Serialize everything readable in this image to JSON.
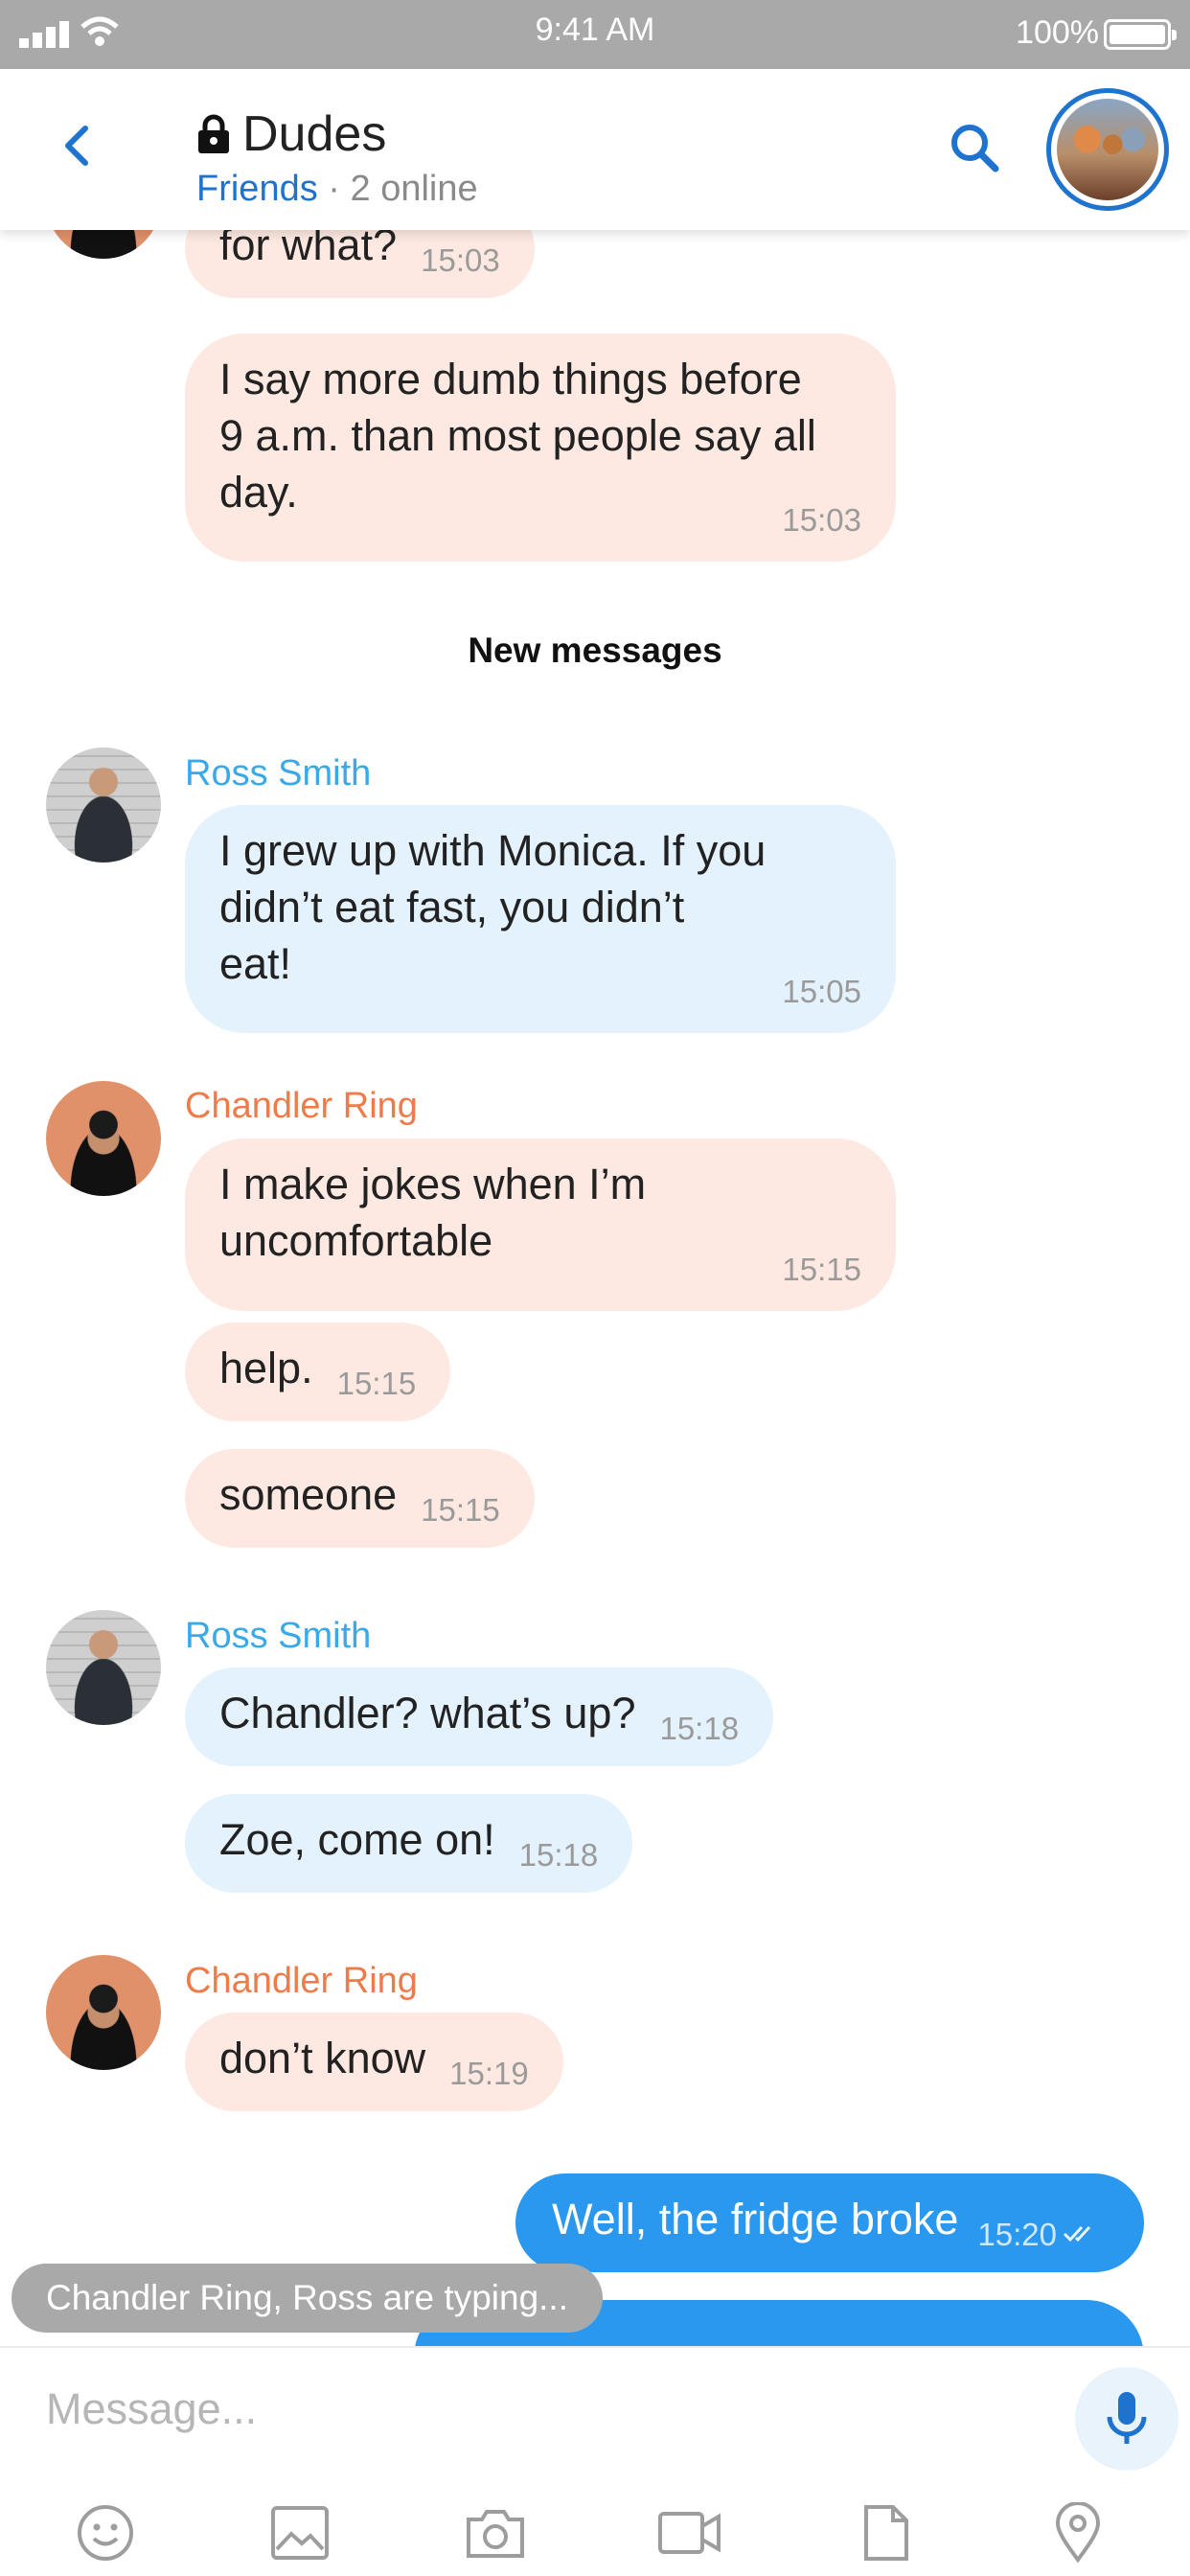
{
  "status_bar": {
    "time": "9:41 AM",
    "battery": "100%"
  },
  "header": {
    "title": "Dudes",
    "group_label": "Friends",
    "subtitle_separator": " · ",
    "online": "2 online"
  },
  "messages": {
    "m1": {
      "text": "for what?",
      "time": "15:03"
    },
    "m2": {
      "line1": "I say more dumb things before",
      "line2": "9 a.m. than most people say all",
      "line3": "day.",
      "time": "15:03"
    },
    "divider": "New messages",
    "ross_name": "Ross Smith",
    "chandler_name": "Chandler Ring",
    "m3": {
      "line1": "I grew up with Monica. If you",
      "line2": "didn’t eat fast, you didn’t",
      "line3": "eat!",
      "time": "15:05"
    },
    "m4": {
      "line1": "I make jokes when I’m",
      "line2": "uncomfortable",
      "time": "15:15"
    },
    "m5": {
      "text": "help.",
      "time": "15:15"
    },
    "m6": {
      "text": "someone",
      "time": "15:15"
    },
    "m7": {
      "text": "Chandler? what’s up?",
      "time": "15:18"
    },
    "m8": {
      "text": "Zoe, come on!",
      "time": "15:18"
    },
    "m9": {
      "text": "don’t know",
      "time": "15:19"
    },
    "out1": {
      "text": "Well, the fridge broke",
      "time": "15:20"
    }
  },
  "typing": "Chandler Ring, Ross are typing...",
  "composer": {
    "placeholder": "Message..."
  },
  "colors": {
    "accent": "#1e73cf",
    "outgoing": "#2a98ee",
    "incoming_peach": "#fde9e1",
    "incoming_blue": "#e3f2fc",
    "ross": "#3aa9e8",
    "chandler": "#f07b4a"
  },
  "icons": [
    "signal-icon",
    "wifi-icon",
    "battery-icon",
    "back-chevron-icon",
    "lock-icon",
    "search-icon",
    "mic-icon",
    "emoji-icon",
    "image-icon",
    "camera-icon",
    "video-icon",
    "file-icon",
    "location-icon",
    "double-check-icon"
  ]
}
